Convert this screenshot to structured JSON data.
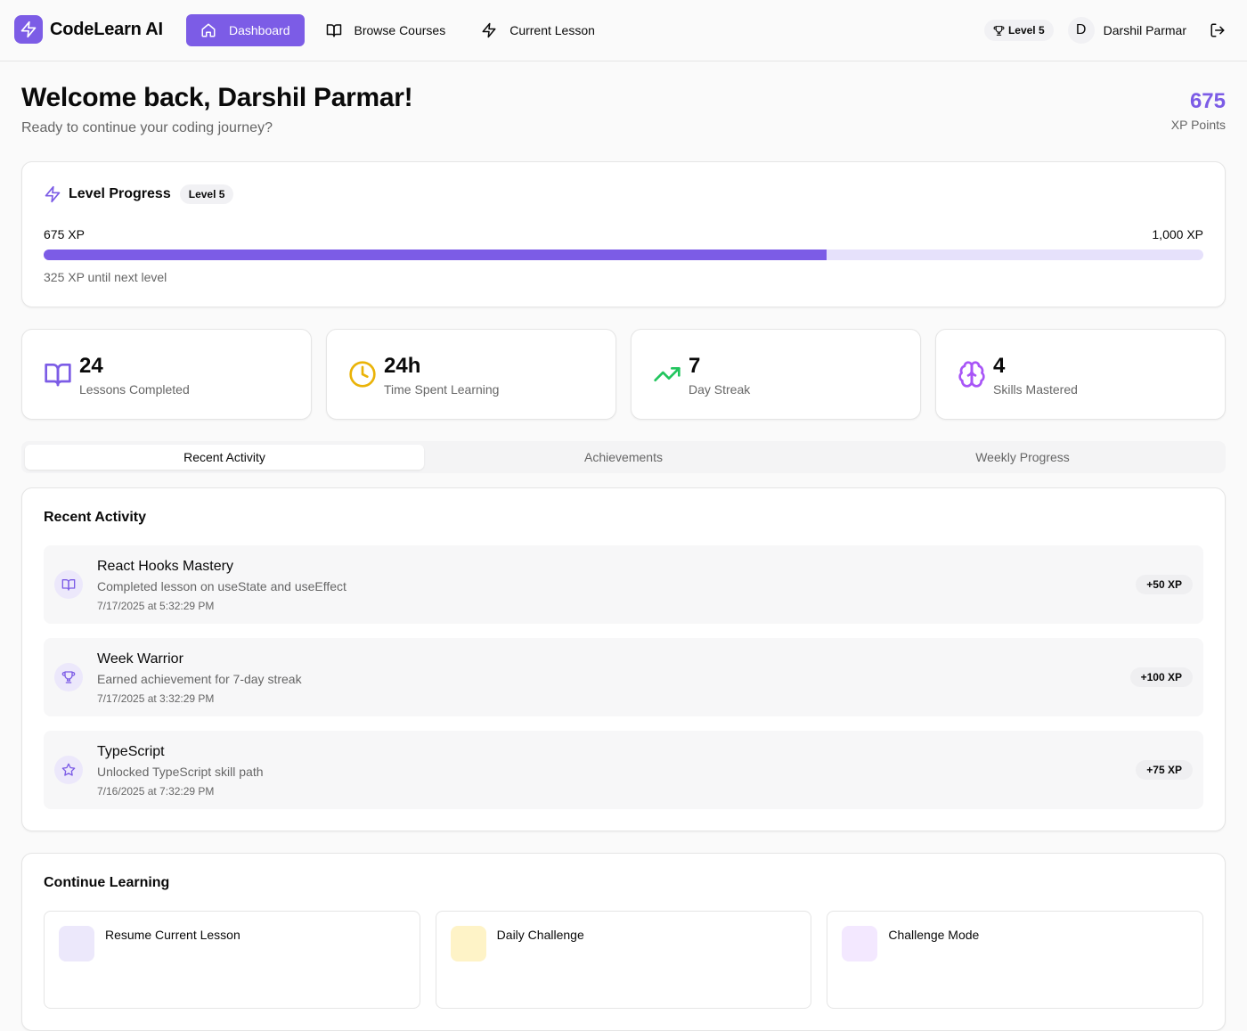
{
  "app": {
    "name": "CodeLearn AI",
    "accent": "#7c5ce6"
  },
  "nav": {
    "items": [
      {
        "label": "Dashboard",
        "icon": "home-icon",
        "active": true
      },
      {
        "label": "Browse Courses",
        "icon": "book-open-icon",
        "active": false
      },
      {
        "label": "Current Lesson",
        "icon": "zap-icon",
        "active": false
      }
    ]
  },
  "user": {
    "level_badge": "Level 5",
    "avatar_initial": "D",
    "name": "Darshil Parmar"
  },
  "welcome": {
    "title": "Welcome back, Darshil Parmar!",
    "subtitle": "Ready to continue your coding journey?",
    "xp_value": "675",
    "xp_label": "XP Points"
  },
  "level_progress": {
    "title": "Level Progress",
    "badge": "Level 5",
    "current_label": "675 XP",
    "target_label": "1,000 XP",
    "progress_fraction": 0.675,
    "note": "325 XP until next level"
  },
  "stats": [
    {
      "value": "24",
      "label": "Lessons Completed",
      "icon": "book-open-icon",
      "color": "#7c5ce6"
    },
    {
      "value": "24h",
      "label": "Time Spent Learning",
      "icon": "clock-icon",
      "color": "#eab308"
    },
    {
      "value": "7",
      "label": "Day Streak",
      "icon": "trending-up-icon",
      "color": "#22c55e"
    },
    {
      "value": "4",
      "label": "Skills Mastered",
      "icon": "brain-icon",
      "color": "#a855f7"
    }
  ],
  "tabs": [
    {
      "label": "Recent Activity",
      "active": true
    },
    {
      "label": "Achievements",
      "active": false
    },
    {
      "label": "Weekly Progress",
      "active": false
    }
  ],
  "recent_activity": {
    "title": "Recent Activity",
    "items": [
      {
        "title": "React Hooks Mastery",
        "description": "Completed lesson on useState and useEffect",
        "time": "7/17/2025 at 5:32:29 PM",
        "xp": "+50 XP",
        "icon": "book-open-icon"
      },
      {
        "title": "Week Warrior",
        "description": "Earned achievement for 7-day streak",
        "time": "7/17/2025 at 3:32:29 PM",
        "xp": "+100 XP",
        "icon": "trophy-icon"
      },
      {
        "title": "TypeScript",
        "description": "Unlocked TypeScript skill path",
        "time": "7/16/2025 at 7:32:29 PM",
        "xp": "+75 XP",
        "icon": "star-icon"
      }
    ]
  },
  "continue_learning": {
    "title": "Continue Learning",
    "items": [
      {
        "label": "Resume Current Lesson",
        "icon_bg": "#ece8fb"
      },
      {
        "label": "Daily Challenge",
        "icon_bg": "#fef3c7"
      },
      {
        "label": "Challenge Mode",
        "icon_bg": "#f3e8ff"
      }
    ]
  }
}
